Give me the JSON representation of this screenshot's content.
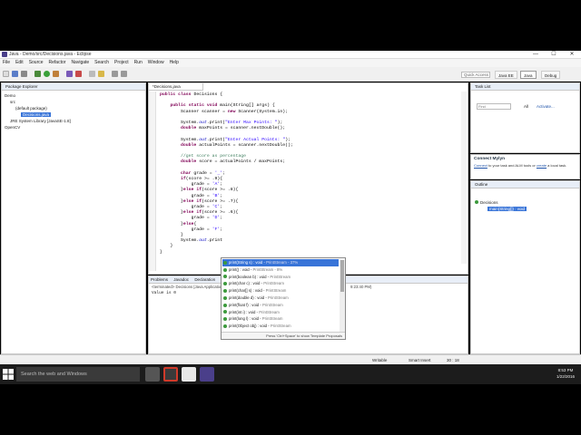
{
  "window": {
    "title": "Java - Demo/src/Decisions.java - Eclipse",
    "minimize": "—",
    "maximize": "☐",
    "close": "✕"
  },
  "menu": [
    "File",
    "Edit",
    "Source",
    "Refactor",
    "Navigate",
    "Search",
    "Project",
    "Run",
    "Window",
    "Help"
  ],
  "toolbar": {
    "quick_access": "Quick Access",
    "perspectives": [
      "Java EE",
      "Java",
      "Debug"
    ]
  },
  "package_explorer": {
    "tab": "Package Explorer",
    "tree": [
      {
        "label": "Demo",
        "indent": 0,
        "selected": false
      },
      {
        "label": "src",
        "indent": 1,
        "selected": false
      },
      {
        "label": "(default package)",
        "indent": 2,
        "selected": false
      },
      {
        "label": "Decisions.java",
        "indent": 3,
        "selected": true
      },
      {
        "label": "JRE System Library [JavaSE-1.8]",
        "indent": 1,
        "selected": false
      },
      {
        "label": "OpenCV",
        "indent": 0,
        "selected": false
      }
    ]
  },
  "editor": {
    "tab": "*Decisions.java",
    "lines": [
      "public class Decisions {",
      "",
      "    public static void main(String[] args) {",
      "        Scanner scanner = new Scanner(System.in);",
      "",
      "        System.out.print(\"Enter Max Points: \");",
      "        double maxPoints = scanner.nextDouble();",
      "",
      "        System.out.print(\"Enter Actual Points: \");",
      "        double actualPoints = scanner.nextDouble();",
      "",
      "        //get score as percentage",
      "        double score = actualPoints / maxPoints;",
      "",
      "        char grade = '_';",
      "        if(score >= .9){",
      "            grade = 'A';",
      "        }else if(score >= .8){",
      "            grade = 'B';",
      "        }else if(score >= .7){",
      "            grade = 'C';",
      "        }else if(score >= .6){",
      "            grade = 'D';",
      "        }else{",
      "            grade = 'F';",
      "        }",
      "        System.out.print",
      "    }",
      "}"
    ]
  },
  "console": {
    "tabs": [
      "Problems",
      "Javadoc",
      "Declaration",
      "Console"
    ],
    "header": "<terminated> Decisions [Java Application]",
    "time": "9:23:40 PM)",
    "output": "Value is 0"
  },
  "content_assist": {
    "items": [
      {
        "name": "print(String s) : void",
        "type": "PrintStream - 37%"
      },
      {
        "name": "print() : void",
        "type": "PrintStream - 8%"
      },
      {
        "name": "print(boolean b) : void",
        "type": "PrintStream"
      },
      {
        "name": "print(char c) : void",
        "type": "PrintStream"
      },
      {
        "name": "print(char[] s) : void",
        "type": "PrintStream"
      },
      {
        "name": "print(double d) : void",
        "type": "PrintStream"
      },
      {
        "name": "print(float f) : void",
        "type": "PrintStream"
      },
      {
        "name": "print(int i) : void",
        "type": "PrintStream"
      },
      {
        "name": "print(long l) : void",
        "type": "PrintStream"
      },
      {
        "name": "print(Object obj) : void",
        "type": "PrintStream"
      }
    ],
    "hint": "Press 'Ctrl+Space' to show Template Proposals"
  },
  "task_list": {
    "tab": "Task List",
    "find_placeholder": "Find",
    "all": "All",
    "activate": "Activate..."
  },
  "connect": {
    "title": "Connect Mylyn",
    "text_link": "Connect",
    "text_rest": " to your task and ALM tools or ",
    "text_link2": "create",
    "text_rest2": " a local task."
  },
  "outline": {
    "tab": "Outline",
    "class_name": "Decisions",
    "method": "main(String[]) : void"
  },
  "status": {
    "writable": "Writable",
    "insert": "Smart Insert",
    "position": "30 : 18"
  },
  "taskbar": {
    "search_placeholder": "Search the web and Windows",
    "time": "8:53 PM",
    "date": "1/22/2016"
  },
  "colors": {
    "taskbar": "#1c1c1c",
    "selection": "#3874d8",
    "keyword": "#7f0055",
    "string": "#2a00ff",
    "comment": "#3f7f5f"
  }
}
